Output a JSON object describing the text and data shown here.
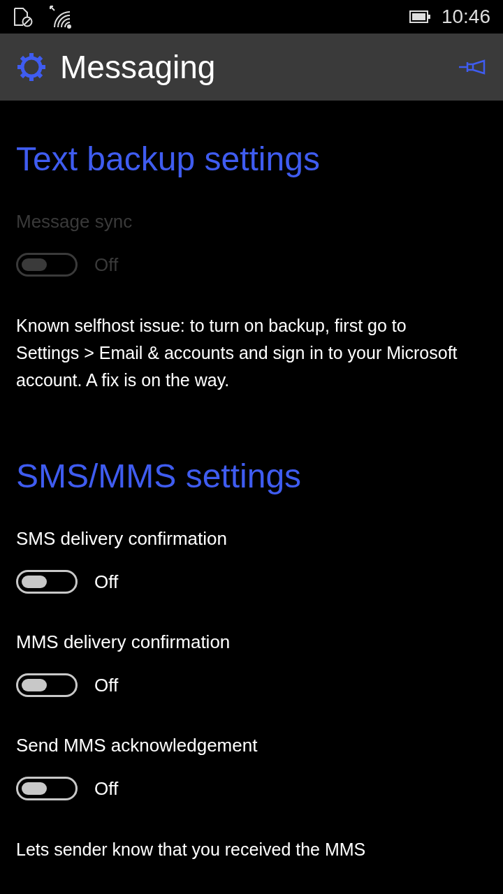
{
  "status_bar": {
    "time": "10:46"
  },
  "header": {
    "title": "Messaging"
  },
  "sections": [
    {
      "title": "Text backup settings",
      "items": [
        {
          "kind": "toggle",
          "label": "Message sync",
          "on": false,
          "disabled": true,
          "state_text": "Off"
        },
        {
          "kind": "note",
          "text": "Known selfhost issue: to turn on backup, first go to Settings > Email & accounts and sign in to your Microsoft account. A fix is on the way."
        }
      ]
    },
    {
      "title": "SMS/MMS settings",
      "items": [
        {
          "kind": "toggle",
          "label": "SMS delivery confirmation",
          "on": false,
          "disabled": false,
          "state_text": "Off"
        },
        {
          "kind": "toggle",
          "label": "MMS delivery confirmation",
          "on": false,
          "disabled": false,
          "state_text": "Off"
        },
        {
          "kind": "toggle",
          "label": "Send MMS acknowledgement",
          "on": false,
          "disabled": false,
          "state_text": "Off"
        },
        {
          "kind": "note",
          "text": "Lets sender know that you received the MMS"
        }
      ]
    }
  ]
}
